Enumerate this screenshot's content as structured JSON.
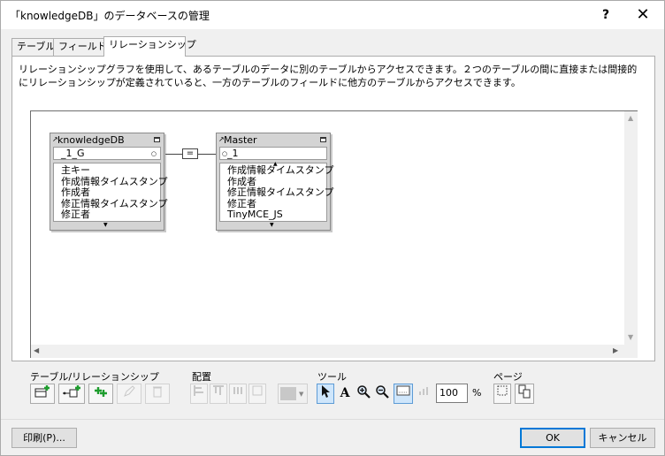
{
  "window": {
    "title": "「knowledgeDB」のデータベースの管理",
    "help": "?",
    "close": "✕"
  },
  "tabs": [
    {
      "label": "テーブル",
      "active": false
    },
    {
      "label": "フィールド",
      "active": false
    },
    {
      "label": "リレーションシップ",
      "active": true
    }
  ],
  "description": "リレーションシップグラフを使用して、あるテーブルのデータに別のテーブルからアクセスできます。２つのテーブルの間に直接または間接的にリレーションシップが定義されていると、一方のテーブルのフィールドに他方のテーブルからアクセスできます。",
  "graph": {
    "tables": [
      {
        "name": "knowledgeDB",
        "key_field": "_1_G",
        "fields": [
          "主キー",
          "作成情報タイムスタンプ",
          "作成者",
          "修正情報タイムスタンプ",
          "修正者"
        ]
      },
      {
        "name": "Master",
        "key_field": "_1",
        "fields": [
          "作成情報タイムスタンプ",
          "作成者",
          "修正情報タイムスタンプ",
          "修正者",
          "TinyMCE_JS"
        ]
      }
    ],
    "relationship_operator": "="
  },
  "toolbar": {
    "groups": {
      "tables": "テーブル/リレーションシップ",
      "arrange": "配置",
      "tools": "ツール",
      "page": "ページ"
    },
    "zoom_value": "100",
    "zoom_unit": "%"
  },
  "footer": {
    "print": "印刷(P)...",
    "ok": "OK",
    "cancel": "キャンセル"
  }
}
